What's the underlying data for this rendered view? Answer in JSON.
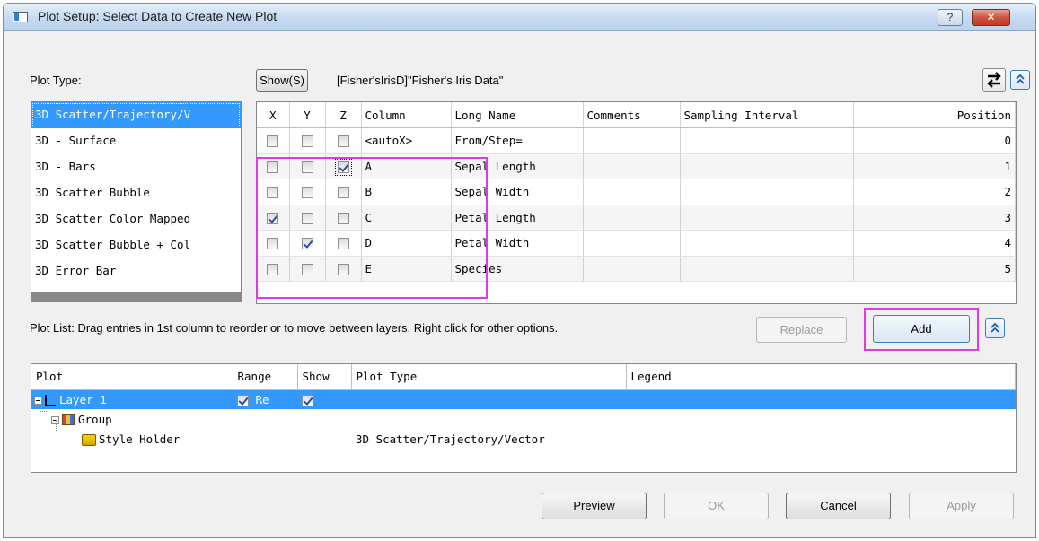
{
  "window": {
    "title": "Plot Setup: Select Data to Create New Plot",
    "help_label": "?",
    "close_label": "✕"
  },
  "plot_type": {
    "label": "Plot Type:",
    "items": [
      "3D Scatter/Trajectory/V",
      "3D - Surface",
      "3D - Bars",
      "3D Scatter Bubble",
      "3D Scatter Color Mapped",
      "3D Scatter Bubble + Col",
      "3D Error Bar"
    ],
    "selected": 0
  },
  "source": {
    "show_button": "Show(S)",
    "path": "[Fisher'sIrisD]\"Fisher's Iris Data\""
  },
  "columns_grid": {
    "headers": [
      "X",
      "Y",
      "Z",
      "Column",
      "Long Name",
      "Comments",
      "Sampling Interval",
      "Position"
    ],
    "rows": [
      {
        "x": false,
        "y": false,
        "z": false,
        "column": "<autoX>",
        "long_name": "From/Step=",
        "comments": "",
        "sampling": "",
        "position": "0"
      },
      {
        "x": false,
        "y": false,
        "z": true,
        "column": "A",
        "long_name": "Sepal Length",
        "comments": "",
        "sampling": "",
        "position": "1"
      },
      {
        "x": false,
        "y": false,
        "z": false,
        "column": "B",
        "long_name": "Sepal Width",
        "comments": "",
        "sampling": "",
        "position": "2"
      },
      {
        "x": true,
        "y": false,
        "z": false,
        "column": "C",
        "long_name": "Petal Length",
        "comments": "",
        "sampling": "",
        "position": "3"
      },
      {
        "x": false,
        "y": true,
        "z": false,
        "column": "D",
        "long_name": "Petal Width",
        "comments": "",
        "sampling": "",
        "position": "4"
      },
      {
        "x": false,
        "y": false,
        "z": false,
        "column": "E",
        "long_name": "Species",
        "comments": "",
        "sampling": "",
        "position": "5"
      }
    ]
  },
  "plot_list": {
    "hint": "Plot List: Drag entries in 1st column to reorder or to move between layers. Right click for other options.",
    "replace_label": "Replace",
    "add_label": "Add",
    "headers": [
      "Plot",
      "Range",
      "Show",
      "Plot Type",
      "Legend"
    ],
    "rows": [
      {
        "plot": "Layer 1",
        "range_checked": true,
        "range_text": "Re",
        "show_checked": true,
        "plot_type": "",
        "legend": ""
      },
      {
        "plot": "Group",
        "plot_type": "",
        "legend": ""
      },
      {
        "plot": "Style Holder",
        "plot_type": "3D Scatter/Trajectory/Vector",
        "legend": ""
      }
    ]
  },
  "footer": {
    "preview": "Preview",
    "ok": "OK",
    "cancel": "Cancel",
    "apply": "Apply"
  },
  "colors": {
    "selection": "#3399ff",
    "highlight": "#e23ae2"
  }
}
